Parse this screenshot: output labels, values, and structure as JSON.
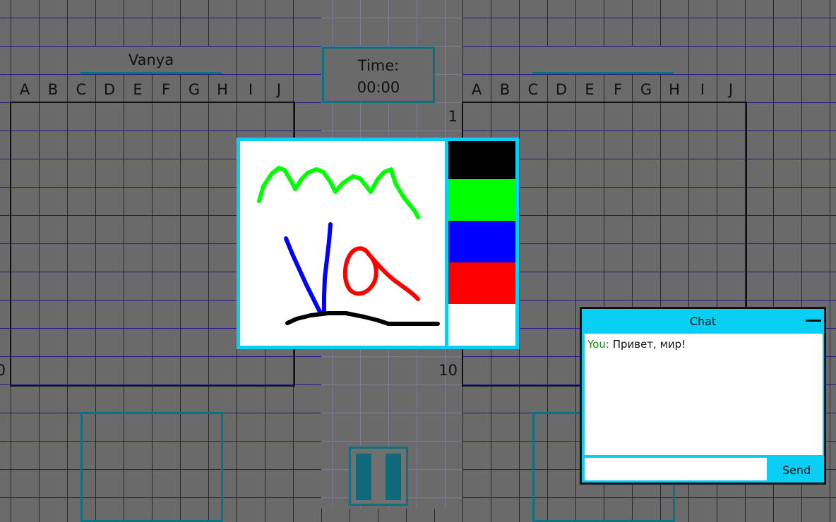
{
  "left_player": {
    "name": "Vanya"
  },
  "right_player": {
    "name": ""
  },
  "timer": {
    "label": "Time:",
    "value": "00:00"
  },
  "columns": [
    "A",
    "B",
    "C",
    "D",
    "E",
    "F",
    "G",
    "H",
    "I",
    "J"
  ],
  "right_rows_visible": [
    "1",
    "10"
  ],
  "left_rows_visible": [
    "0"
  ],
  "palette": [
    {
      "name": "black",
      "color": "#000000"
    },
    {
      "name": "green",
      "color": "#00ff00"
    },
    {
      "name": "blue",
      "color": "#0000ff"
    },
    {
      "name": "red",
      "color": "#ff0000"
    },
    {
      "name": "white",
      "color": "#ffffff"
    }
  ],
  "chat": {
    "title": "Chat",
    "messages": [
      {
        "user": "You",
        "separator": ":",
        "text": " Привет, мир!"
      }
    ],
    "input_value": "",
    "input_placeholder": "",
    "send_label": "Send"
  }
}
